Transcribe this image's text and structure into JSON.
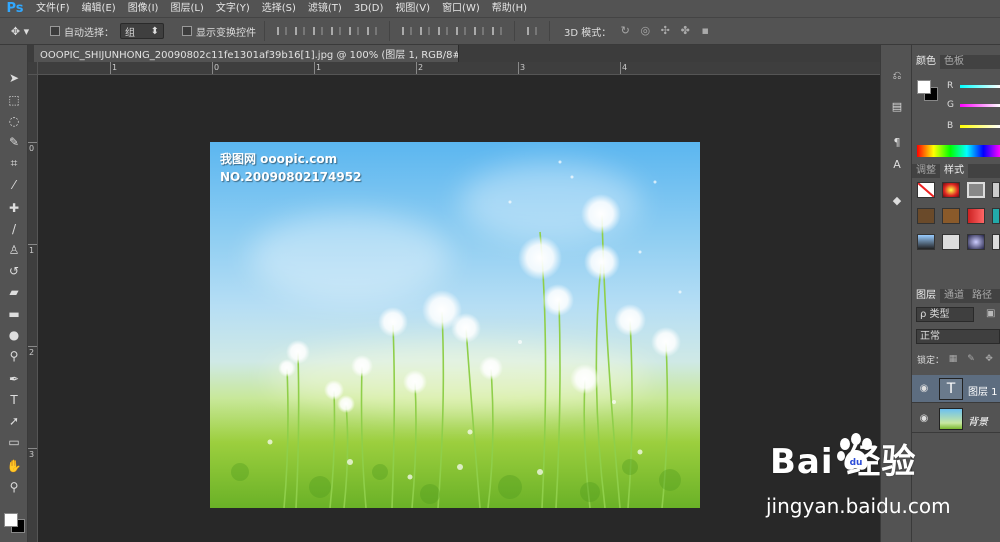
{
  "app": {
    "logo": "Ps"
  },
  "menu": [
    "文件(F)",
    "编辑(E)",
    "图像(I)",
    "图层(L)",
    "文字(Y)",
    "选择(S)",
    "滤镜(T)",
    "3D(D)",
    "视图(V)",
    "窗口(W)",
    "帮助(H)"
  ],
  "options": {
    "auto_select_label": "自动选择：",
    "auto_select_value": "组",
    "show_transform_label": "显示变换控件",
    "mode3d_label": "3D 模式："
  },
  "document": {
    "tab_title": "OOOPIC_SHIJUNHONG_20090802c11fe1301af39b16[1].jpg @ 100% (图层 1, RGB/8#) *",
    "close": "×"
  },
  "rulers": {
    "top_labels": [
      "1",
      "0",
      "1",
      "2",
      "3",
      "4"
    ],
    "left_labels": [
      "0",
      "1",
      "2",
      "3"
    ]
  },
  "image": {
    "watermark_line1": "我图网 ooopic.com",
    "watermark_line2": "NO.20090802174952"
  },
  "panels": {
    "color_tabs": [
      "颜色",
      "色板"
    ],
    "rgb_labels": [
      "R",
      "G",
      "B"
    ],
    "style_tabs": [
      "调整",
      "样式"
    ],
    "layer_tabs": [
      "图层",
      "通道",
      "路径"
    ],
    "filter_type": "ρ 类型",
    "blend_mode": "正常",
    "lock_label": "锁定：",
    "layers": [
      {
        "name": "图层 1",
        "selected": true,
        "thumb": "T"
      },
      {
        "name": "背景",
        "selected": false,
        "thumb": ""
      }
    ]
  },
  "overlay": {
    "logo_text": "Bai 经验",
    "url": "jingyan.baidu.com"
  },
  "colors": {
    "accent_blue": "#31a8ff",
    "sky": "#5bb6f0",
    "grass": "#6ab127"
  }
}
